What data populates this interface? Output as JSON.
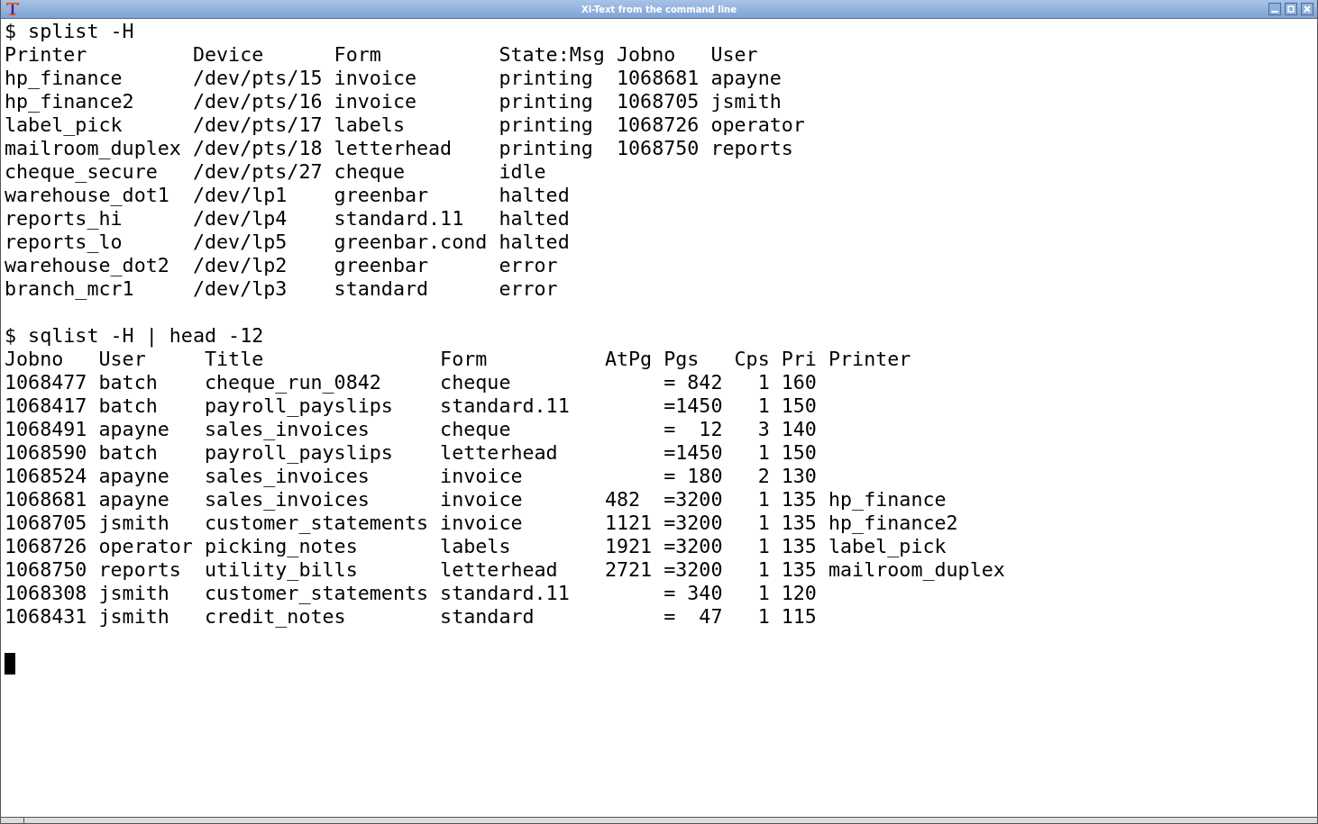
{
  "window": {
    "title": "Xi-Text from the command line"
  },
  "terminal": {
    "blocks": [
      {
        "command": "$ splist -H",
        "lines": [
          "Printer         Device      Form          State:Msg Jobno   User",
          "hp_finance      /dev/pts/15 invoice       printing  1068681 apayne",
          "hp_finance2     /dev/pts/16 invoice       printing  1068705 jsmith",
          "label_pick      /dev/pts/17 labels        printing  1068726 operator",
          "mailroom_duplex /dev/pts/18 letterhead    printing  1068750 reports",
          "cheque_secure   /dev/pts/27 cheque        idle",
          "warehouse_dot1  /dev/lp1    greenbar      halted",
          "reports_hi      /dev/lp4    standard.11   halted",
          "reports_lo      /dev/lp5    greenbar.cond halted",
          "warehouse_dot2  /dev/lp2    greenbar      error",
          "branch_mcr1     /dev/lp3    standard      error"
        ]
      },
      {
        "command": "$ sqlist -H | head -12",
        "lines": [
          "Jobno   User     Title               Form          AtPg Pgs   Cps Pri Printer",
          "1068477 batch    cheque_run_0842     cheque             = 842   1 160",
          "1068417 batch    payroll_payslips    standard.11        =1450   1 150",
          "1068491 apayne   sales_invoices      cheque             =  12   3 140",
          "1068590 batch    payroll_payslips    letterhead         =1450   1 150",
          "1068524 apayne   sales_invoices      invoice            = 180   2 130",
          "1068681 apayne   sales_invoices      invoice       482  =3200   1 135 hp_finance",
          "1068705 jsmith   customer_statements invoice       1121 =3200   1 135 hp_finance2",
          "1068726 operator picking_notes       labels        1921 =3200   1 135 label_pick",
          "1068750 reports  utility_bills       letterhead    2721 =3200   1 135 mailroom_duplex",
          "1068308 jsmith   customer_statements standard.11        = 340   1 120",
          "1068431 jsmith   credit_notes        standard           =  47   1 115"
        ]
      }
    ]
  }
}
